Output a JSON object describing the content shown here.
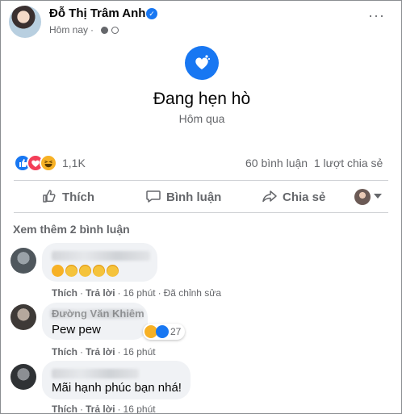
{
  "post": {
    "author": "Đỗ Thị Trâm Anh",
    "time": "Hôm nay",
    "more_label": "···",
    "life_event_title": "Đang hẹn hò",
    "life_event_date": "Hôm qua",
    "reaction_count": "1,1K",
    "comment_count": "60 bình luận",
    "share_count": "1 lượt chia sẻ",
    "accent_color": "#1877f2"
  },
  "actions": {
    "like": "Thích",
    "comment": "Bình luận",
    "share": "Chia sẻ"
  },
  "comments_section": {
    "see_more": "Xem thêm 2 bình luận",
    "comments": [
      {
        "name": "",
        "text": "",
        "like": "Thích",
        "reply": "Trả lời",
        "time": "16 phút",
        "edited": "Đã chỉnh sửa"
      },
      {
        "name": "Đường Văn Khiêm",
        "text": "Pew pew",
        "reaction_count": "27",
        "like": "Thích",
        "reply": "Trả lời",
        "time": "16 phút"
      },
      {
        "name": "",
        "text": "Mãi hạnh phúc bạn nhá!",
        "like": "Thích",
        "reply": "Trả lời",
        "time": "16 phút"
      }
    ]
  }
}
